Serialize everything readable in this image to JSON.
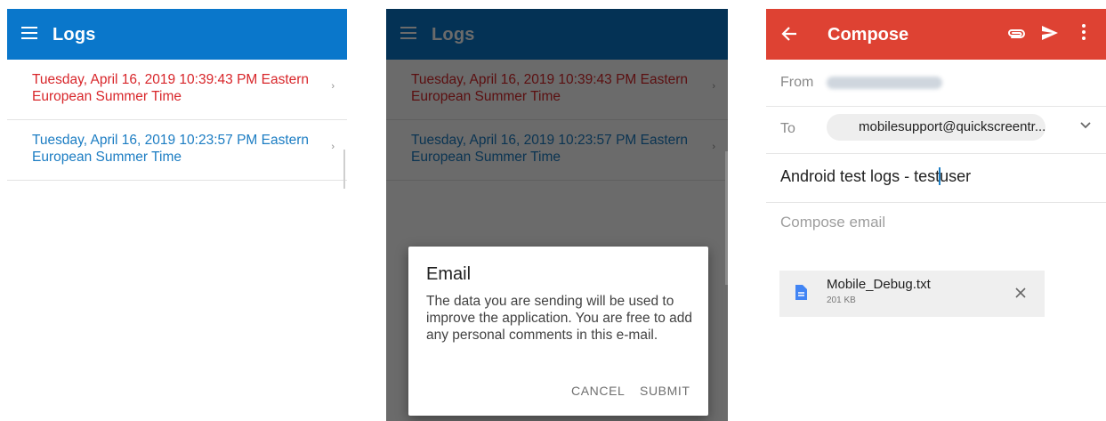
{
  "logs_screen": {
    "title": "Logs",
    "entries": [
      {
        "text": "Tuesday, April 16, 2019 10:39:43 PM Eastern European Summer Time",
        "color": "#d8262a"
      },
      {
        "text": "Tuesday, April 16, 2019 10:23:57 PM Eastern European Summer Time",
        "color": "#1c7dc3"
      }
    ],
    "chevron": "›"
  },
  "email_dialog": {
    "title": "Email",
    "message": "The data you are sending will be used to improve the application. You are free to add any personal comments in this e-mail.",
    "cancel_label": "CANCEL",
    "submit_label": "SUBMIT"
  },
  "compose_screen": {
    "title": "Compose",
    "from_label": "From",
    "to_label": "To",
    "to_recipient": "mobilesupport@quickscreentr...",
    "subject_before_cursor": "Android test logs - test",
    "subject_after_cursor": "user",
    "body_placeholder": "Compose email",
    "attachment": {
      "name": "Mobile_Debug.txt",
      "size": "201 KB"
    },
    "icons": [
      "back-arrow-icon",
      "paperclip-icon",
      "send-icon",
      "more-vert-icon",
      "chevron-down-icon",
      "document-icon",
      "close-icon"
    ]
  },
  "colors": {
    "logs_bar": "#0a77cb",
    "compose_bar": "#de4233",
    "accent_blue": "#1c7dc3",
    "accent_red": "#d8262a"
  }
}
